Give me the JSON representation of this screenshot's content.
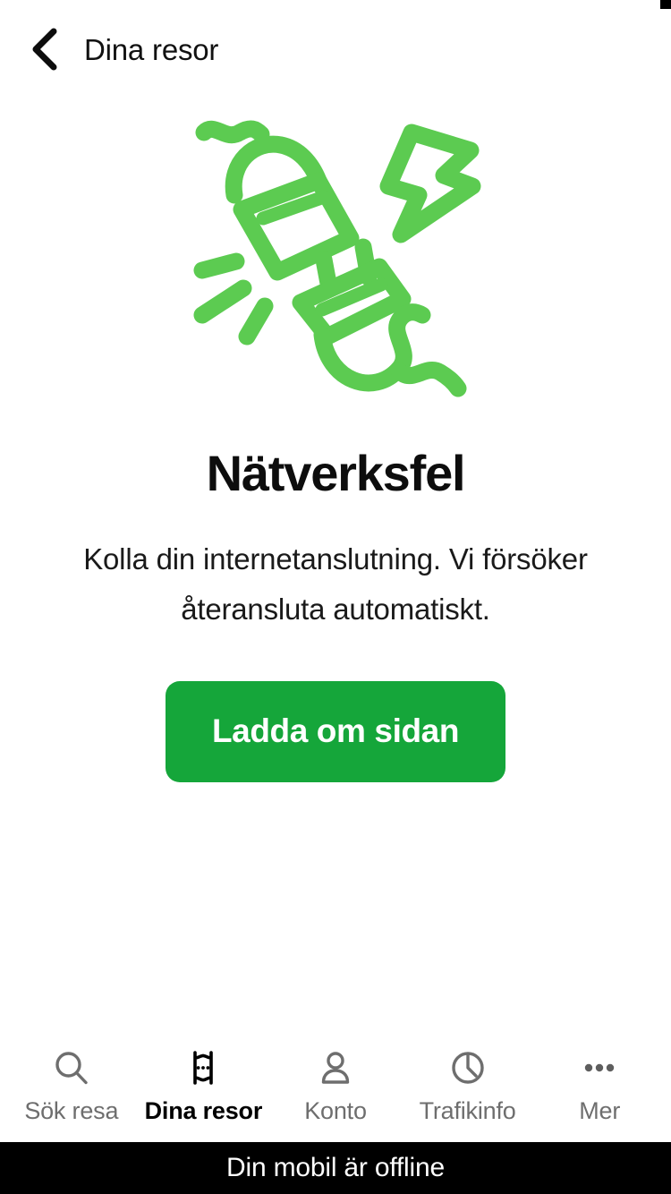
{
  "header": {
    "back_icon": "chevron-left-icon",
    "title": "Dina resor"
  },
  "illustration": {
    "name": "disconnected-plug-illustration",
    "color": "#5CCB51",
    "parts": [
      "socket-half",
      "plug-half",
      "lightning-bolt",
      "motion-lines",
      "cord"
    ]
  },
  "main": {
    "title": "Nätverksfel",
    "body": "Kolla din internetanslutning. Vi försöker återansluta automatiskt.",
    "button_label": "Ladda om sidan",
    "button_color": "#15A63A"
  },
  "tabbar": {
    "items": [
      {
        "label": "Sök resa",
        "icon": "search-icon",
        "active": false
      },
      {
        "label": "Dina resor",
        "icon": "ticket-icon",
        "active": true
      },
      {
        "label": "Konto",
        "icon": "person-icon",
        "active": false
      },
      {
        "label": "Trafikinfo",
        "icon": "clock-icon",
        "active": false
      },
      {
        "label": "Mer",
        "icon": "ellipsis-icon",
        "active": false
      }
    ],
    "active_color": "#000000",
    "inactive_color": "#6E6E6E"
  },
  "banner": {
    "text": "Din mobil är offline",
    "background": "#000000",
    "color": "#FFFFFF"
  }
}
